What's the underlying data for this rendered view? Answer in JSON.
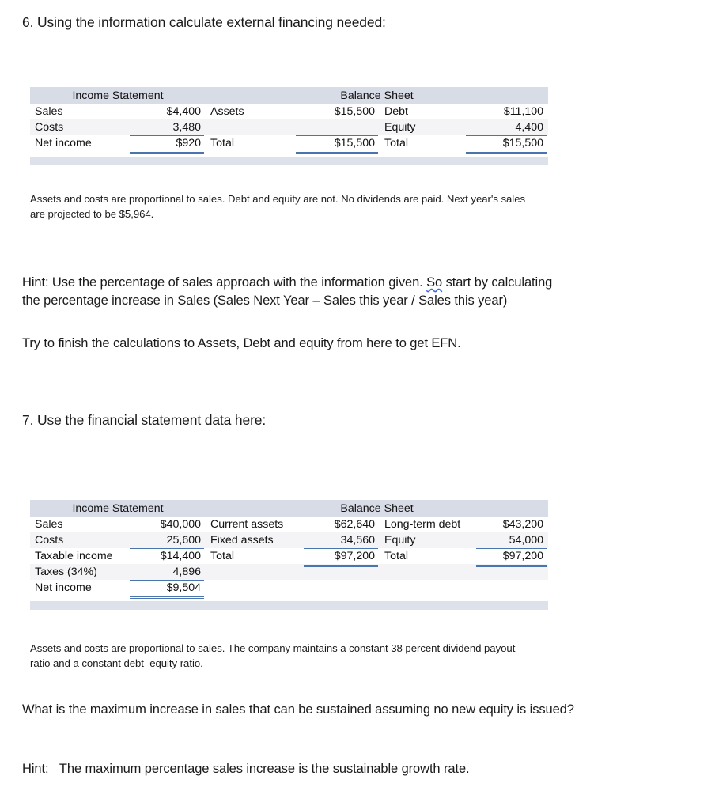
{
  "questions": {
    "q6_heading": "6. Using the information calculate external financing needed:",
    "q7_heading": "7. Use the financial statement data here:"
  },
  "q6_note_line1": "Assets and costs are proportional to sales. Debt and equity are not. No dividends are paid. Next year's sales",
  "q6_note_line2": "are projected to be $5,964.",
  "hint1": {
    "line1_a": "Hint: Use the percentage of sales approach with the information given. ",
    "line1_spell": "So",
    "line1_b": " start by calculating",
    "line2": "the percentage increase in Sales (Sales Next Year – Sales this year / Sales this year)"
  },
  "try_line": "Try to finish the calculations to Assets, Debt and equity from here to get EFN.",
  "q7_note_line1": "Assets and costs are proportional to sales. The company maintains a constant 38 percent dividend payout",
  "q7_note_line2": "ratio and a constant debt–equity ratio.",
  "q7_question": "What is the maximum increase in sales that can be sustained assuming no new equity is issued?",
  "hint2": {
    "label": "Hint:",
    "text": "The maximum percentage sales increase is the sustainable growth rate."
  },
  "table1": {
    "header_income": "Income Statement",
    "header_balance": "Balance Sheet",
    "rows": [
      {
        "is_label": "Sales",
        "is_value": "$4,400",
        "ba_label": "Assets",
        "ba_value": "$15,500",
        "bl_label": "Debt",
        "bl_value": "$11,100"
      },
      {
        "is_label": "Costs",
        "is_value": "3,480",
        "ba_label": "",
        "ba_value": "",
        "bl_label": "Equity",
        "bl_value": "4,400"
      },
      {
        "is_label": "Net income",
        "is_value": "$920",
        "ba_label": "Total",
        "ba_value": "$15,500",
        "bl_label": "Total",
        "bl_value": "$15,500"
      }
    ]
  },
  "table2": {
    "header_income": "Income Statement",
    "header_balance": "Balance Sheet",
    "rows": [
      {
        "is_label": "Sales",
        "is_value": "$40,000",
        "ba_label": "Current assets",
        "ba_value": "$62,640",
        "bl_label": "Long-term debt",
        "bl_value": "$43,200"
      },
      {
        "is_label": "Costs",
        "is_value": "25,600",
        "ba_label": "Fixed assets",
        "ba_value": "34,560",
        "bl_label": "Equity",
        "bl_value": "54,000"
      },
      {
        "is_label": "Taxable income",
        "is_value": "$14,400",
        "ba_label": "Total",
        "ba_value": "$97,200",
        "bl_label": "Total",
        "bl_value": "$97,200"
      },
      {
        "is_label": "Taxes (34%)",
        "is_value": "4,896",
        "ba_label": "",
        "ba_value": "",
        "bl_label": "",
        "bl_value": ""
      },
      {
        "is_label": "Net income",
        "is_value": "$9,504",
        "ba_label": "",
        "ba_value": "",
        "bl_label": "",
        "bl_value": ""
      }
    ]
  },
  "colors": {
    "header_bar": "#d8dce7",
    "footer_bar": "#dde1ea",
    "row_shade": "#f4f4f6",
    "rule_blue": "#4a74ad",
    "spellcheck": "#3b6bd6"
  }
}
